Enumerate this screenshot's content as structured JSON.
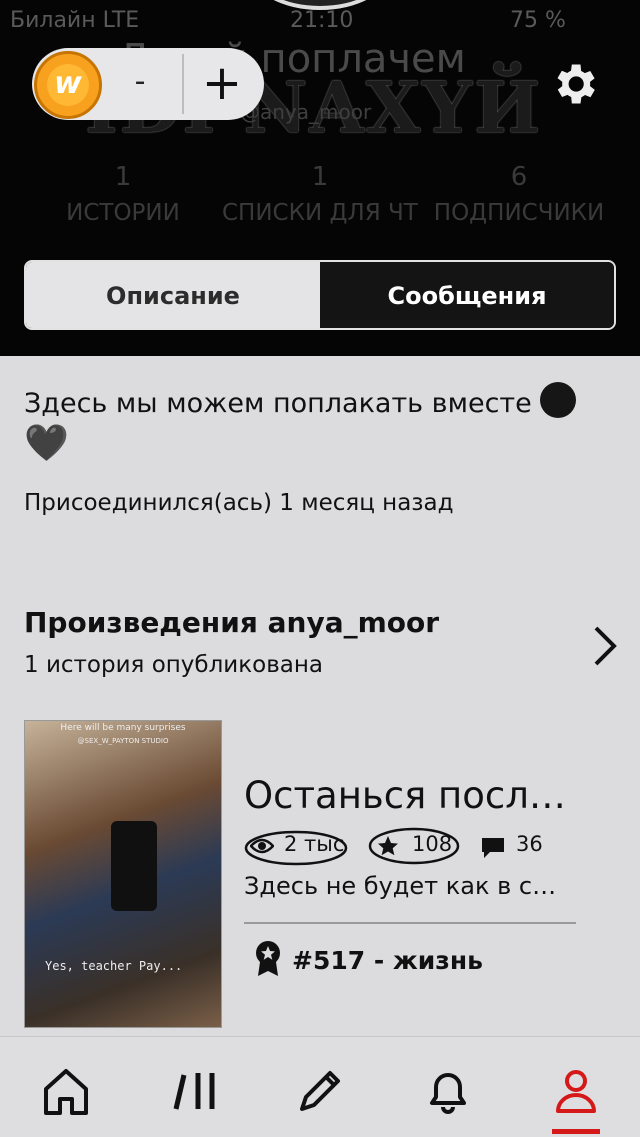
{
  "status_bar": {
    "carrier": "Билайн LTE",
    "time": "21:10",
    "battery": "75 %"
  },
  "profile": {
    "display_name": "Давай поплачем",
    "username": "@anya_moor",
    "banner_text": "IDI NAXYЙ",
    "stats": [
      {
        "value": "1",
        "label": "ИСТОРИИ"
      },
      {
        "value": "1",
        "label": "СПИСКИ ДЛЯ ЧТЕНИЯ"
      },
      {
        "value": "6",
        "label": "ПОДПИСЧИКИ"
      }
    ]
  },
  "coins": {
    "minus": "-",
    "plus": "+",
    "icon": "wattpad-coin-icon"
  },
  "tabs": [
    {
      "label": "Описание",
      "active": false
    },
    {
      "label": "Сообщения",
      "active": true
    }
  ],
  "bio": {
    "text": "Здесь мы можем поплакать вместе",
    "heart": "🖤"
  },
  "joined": "Присоединился(ась) 1 месяц назад",
  "works": {
    "title": "Произведения",
    "username": "anya_moor",
    "subtitle": "1 история опубликована"
  },
  "story": {
    "cover_top_text": "Here will be many surprises",
    "cover_studio": "@SEX_W_PAYTON STUDIO",
    "cover_caption": "Yes, teacher Pay...",
    "title": "Останься посл…",
    "reads": "2 тыс",
    "votes": "108",
    "comments": "36",
    "description": "Здесь не будет как в с…",
    "rank": "#517 - жизнь"
  },
  "colors": {
    "accent": "#d51818",
    "header_bg": "#050505",
    "page_bg": "#dcdcdf"
  }
}
